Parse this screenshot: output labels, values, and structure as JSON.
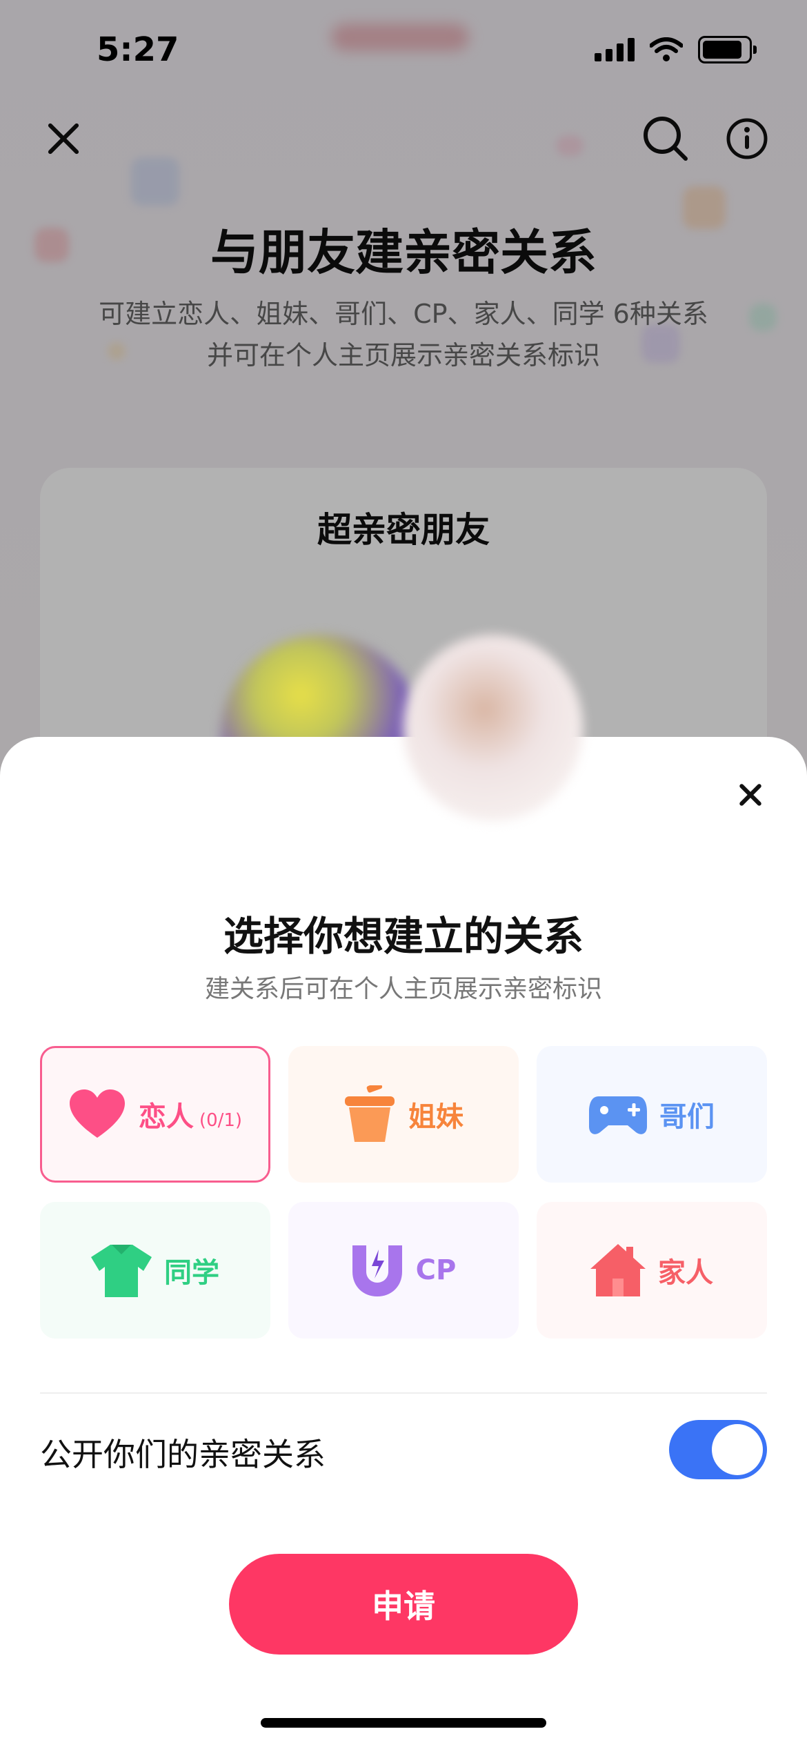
{
  "status": {
    "time": "5:27"
  },
  "background": {
    "title": "与朋友建亲密关系",
    "subtitle_line1": "可建立恋人、姐妹、哥们、CP、家人、同学 6种关系",
    "subtitle_line2": "并可在个人主页展示亲密关系标识",
    "card_title": "超亲密朋友"
  },
  "sheet": {
    "title": "选择你想建立的关系",
    "subtitle": "建关系后可在个人主页展示亲密标识",
    "relations": [
      {
        "label": "恋人",
        "count": "(0/1)",
        "icon": "heart-icon",
        "color": "#fd4f86",
        "selected": true
      },
      {
        "label": "姐妹",
        "icon": "cup-icon",
        "color": "#f7843b"
      },
      {
        "label": "哥们",
        "icon": "gamepad-icon",
        "color": "#5b93f2"
      },
      {
        "label": "同学",
        "icon": "tshirt-icon",
        "color": "#2fcf83"
      },
      {
        "label": "CP",
        "icon": "magnet-icon",
        "color": "#a875ec"
      },
      {
        "label": "家人",
        "icon": "house-icon",
        "color": "#f65f67"
      }
    ],
    "toggle_label": "公开你们的亲密关系",
    "toggle_on": true,
    "apply_label": "申请"
  }
}
